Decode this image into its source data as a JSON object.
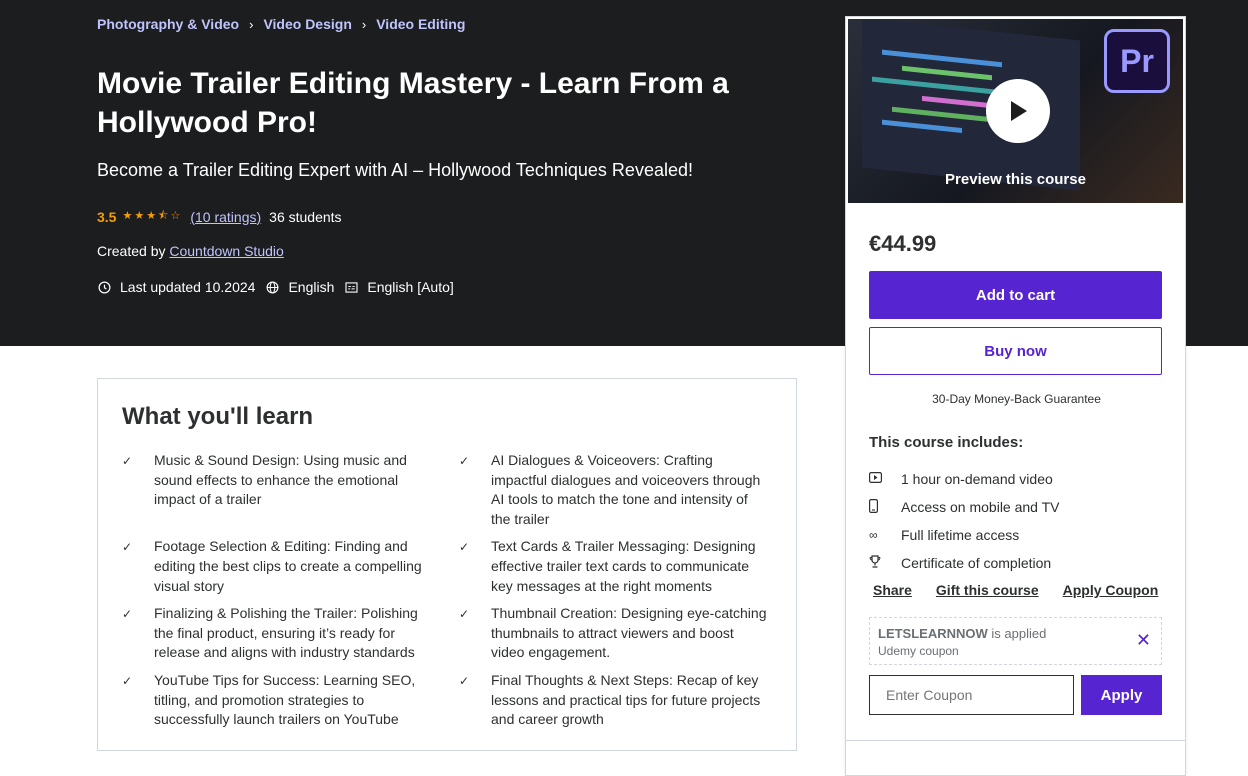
{
  "breadcrumb": [
    "Photography & Video",
    "Video Design",
    "Video Editing"
  ],
  "course": {
    "title": "Movie Trailer Editing Mastery - Learn From a Hollywood Pro!",
    "subtitle": "Become a Trailer Editing Expert with AI – Hollywood Techniques Revealed!",
    "rating": "3.5",
    "rating_value": 3.5,
    "ratings_count": "(10 ratings)",
    "students": "36 students",
    "created_by_label": "Created by",
    "instructor": "Countdown Studio",
    "last_updated": "Last updated 10.2024",
    "language": "English",
    "captions": "English [Auto]"
  },
  "learn": {
    "heading": "What you'll learn",
    "items": [
      "Music & Sound Design: Using music and sound effects to enhance the emotional impact of a trailer",
      "AI Dialogues & Voiceovers: Crafting impactful dialogues and voiceovers through AI tools to match the tone and intensity of the trailer",
      "Footage Selection & Editing: Finding and editing the best clips to create a compelling visual story",
      "Text Cards & Trailer Messaging: Designing effective trailer text cards to communicate key messages at the right moments",
      "Finalizing & Polishing the Trailer: Polishing the final product, ensuring it’s ready for release and aligns with industry standards",
      "Thumbnail Creation: Designing eye-catching thumbnails to attract viewers and boost video engagement.",
      "YouTube Tips for Success: Learning SEO, titling, and promotion strategies to successfully launch trailers on YouTube",
      "Final Thoughts & Next Steps: Recap of key lessons and practical tips for future projects and career growth"
    ]
  },
  "sidebar": {
    "preview_label": "Preview this course",
    "app_logo_text": "Pr",
    "price": "€44.99",
    "add_to_cart": "Add to cart",
    "buy_now": "Buy now",
    "guarantee": "30-Day Money-Back Guarantee",
    "includes_title": "This course includes:",
    "includes": [
      {
        "icon": "video-icon",
        "label": "1 hour on-demand video"
      },
      {
        "icon": "mobile-icon",
        "label": "Access on mobile and TV"
      },
      {
        "icon": "infinity-icon",
        "label": "Full lifetime access"
      },
      {
        "icon": "trophy-icon",
        "label": "Certificate of completion"
      }
    ],
    "share": "Share",
    "gift": "Gift this course",
    "apply_coupon": "Apply Coupon",
    "coupon_code": "LETSLEARNNOW",
    "coupon_applied": "is applied",
    "coupon_sub": "Udemy coupon",
    "coupon_placeholder": "Enter Coupon",
    "apply_button": "Apply"
  },
  "colors": {
    "hero_bg": "#1c1d1f",
    "accent": "#5624d0",
    "link": "#c0c4fc",
    "star": "#f69c08"
  }
}
